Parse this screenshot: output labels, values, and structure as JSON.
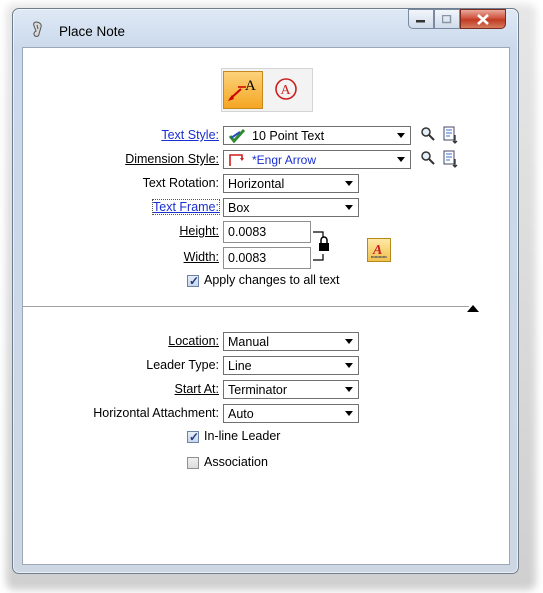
{
  "window": {
    "title": "Place Note",
    "minimize_label": "—",
    "maximize_label": "□",
    "close_label": "X"
  },
  "form": {
    "text_style": {
      "label": "Text Style:",
      "value": "10 Point Text"
    },
    "dimension_style": {
      "label": "Dimension Style:",
      "value": "*Engr Arrow"
    },
    "text_rotation": {
      "label": "Text Rotation:",
      "value": "Horizontal"
    },
    "text_frame": {
      "label": "Text Frame:",
      "value": "Box"
    },
    "height": {
      "label": "Height:",
      "value": "0.0083"
    },
    "width": {
      "label": "Width:",
      "value": "0.0083"
    },
    "apply_changes": {
      "label": "Apply changes to all text",
      "checked": true
    },
    "location": {
      "label": "Location:",
      "value": "Manual"
    },
    "leader_type": {
      "label": "Leader Type:",
      "value": "Line"
    },
    "start_at": {
      "label": "Start At:",
      "value": "Terminator"
    },
    "horizontal_attachment": {
      "label": "Horizontal Attachment:",
      "value": "Auto"
    },
    "inline_leader": {
      "label": "In-line Leader",
      "checked": true
    },
    "association": {
      "label": "Association",
      "checked": false
    }
  },
  "icons": {
    "place_note_tool": "note-with-leader-icon",
    "place_callout_tool": "circled-a-icon",
    "zoom": "magnifier-icon",
    "edit": "edit-style-icon",
    "lock": "lock-icon",
    "text_attributes": "text-attributes-icon",
    "collapse": "triangle-up-icon"
  },
  "colors": {
    "link_label": "#1a2fd0",
    "active_tool_bg": "#f7b23b",
    "close_button": "#c23b22",
    "callout_red": "#cc1f1f"
  }
}
